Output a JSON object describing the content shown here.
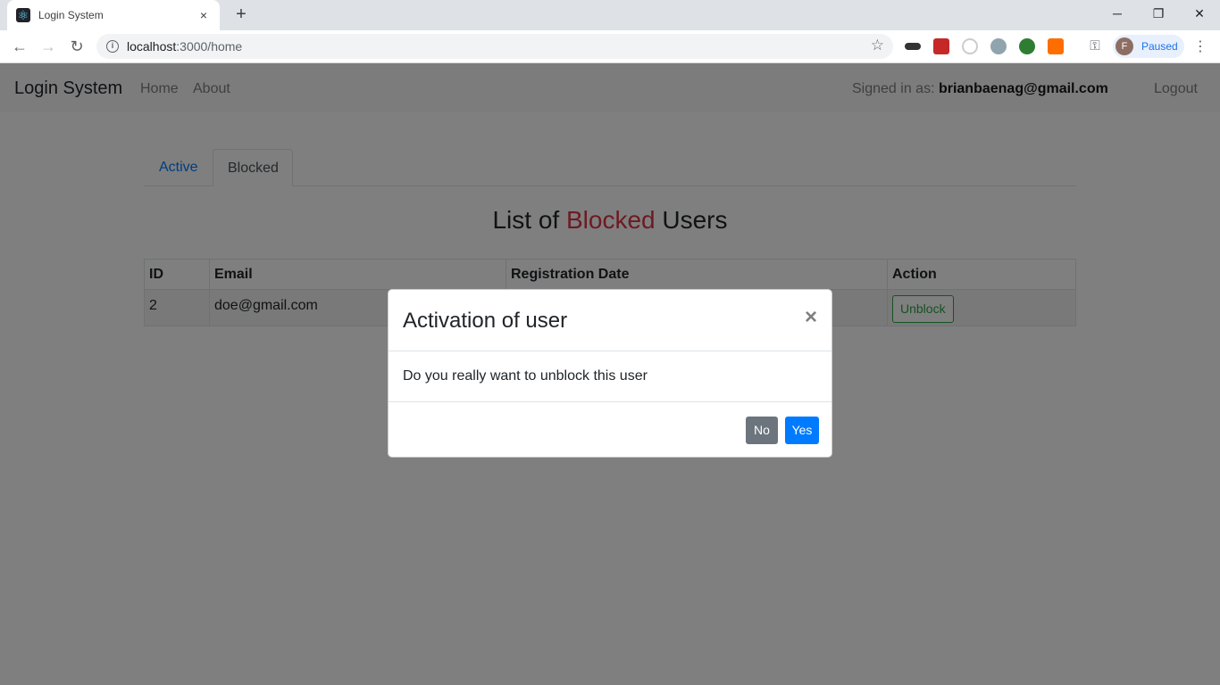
{
  "browser": {
    "tab_title": "Login System",
    "tab_close": "×",
    "new_tab": "+",
    "url_host": "localhost",
    "url_rest": ":3000/home",
    "profile_initial": "F",
    "profile_status": "Paused"
  },
  "navbar": {
    "brand": "Login System",
    "links": [
      "Home",
      "About"
    ],
    "signed_label": "Signed in as: ",
    "signed_email": "brianbaenag@gmail.com",
    "logout": "Logout"
  },
  "tabs": [
    "Active",
    "Blocked"
  ],
  "heading": {
    "prefix": "List of ",
    "highlight": "Blocked",
    "suffix": " Users"
  },
  "table": {
    "headers": [
      "ID",
      "Email",
      "Registration Date",
      "Action"
    ],
    "rows": [
      {
        "id": "2",
        "email": "doe@gmail.com",
        "registration_date": "",
        "action": "Unblock"
      }
    ]
  },
  "modal": {
    "title": "Activation of user",
    "close": "×",
    "body": "Do you really want to unblock this user",
    "no": "No",
    "yes": "Yes"
  },
  "colors": {
    "accent": "#007bff",
    "danger": "#dc3545",
    "success": "#28a745",
    "secondary": "#6c757d"
  }
}
